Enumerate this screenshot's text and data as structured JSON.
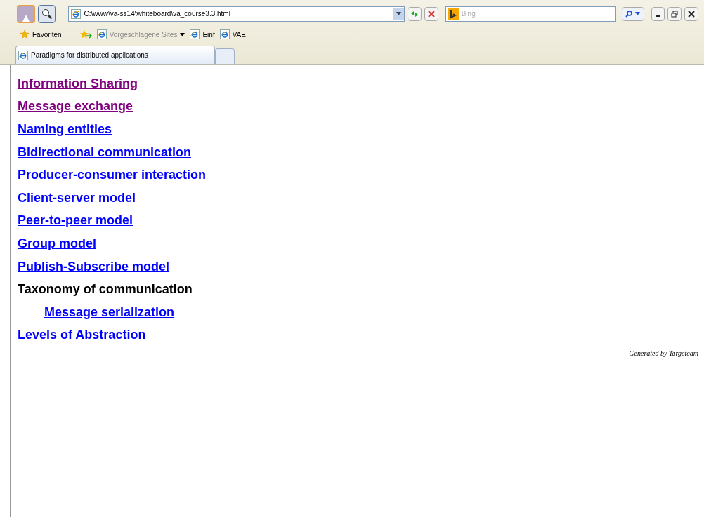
{
  "address_bar": {
    "url": "C:\\www\\va-ss14\\whiteboard\\va_course3.3.html"
  },
  "search": {
    "placeholder": "Bing"
  },
  "favorites_bar": {
    "favorites": "Favoriten",
    "items": [
      {
        "label": "Vorgeschlagene Sites",
        "kind": "dropdown",
        "disabled": true
      },
      {
        "label": "Einf",
        "kind": "page",
        "disabled": false
      },
      {
        "label": "VAE",
        "kind": "page",
        "disabled": false
      }
    ]
  },
  "tabs": [
    {
      "label": "Paradigms for distributed applications",
      "selected": true
    },
    {
      "selected": false
    }
  ],
  "outline": [
    {
      "title": "Information Sharing",
      "kind": "link",
      "visited": true
    },
    {
      "title": "Message exchange",
      "kind": "link",
      "visited": true
    },
    {
      "title": "Naming entities",
      "kind": "link",
      "visited": false
    },
    {
      "title": "Bidirectional communication",
      "kind": "link",
      "visited": false
    },
    {
      "title": "Producer-consumer interaction",
      "kind": "link",
      "visited": false
    },
    {
      "title": "Client-server model",
      "kind": "link",
      "visited": false
    },
    {
      "title": "Peer-to-peer model",
      "kind": "link",
      "visited": false
    },
    {
      "title": "Group model",
      "kind": "link",
      "visited": false
    },
    {
      "title": "Publish-Subscribe model",
      "kind": "link",
      "visited": false
    },
    {
      "title": "Taxonomy of communication",
      "kind": "heading",
      "children": [
        {
          "title": "Message serialization",
          "kind": "link",
          "visited": false
        }
      ]
    },
    {
      "title": "Levels of Abstraction",
      "kind": "link",
      "visited": false
    }
  ],
  "footer": "Generated by Targeteam"
}
